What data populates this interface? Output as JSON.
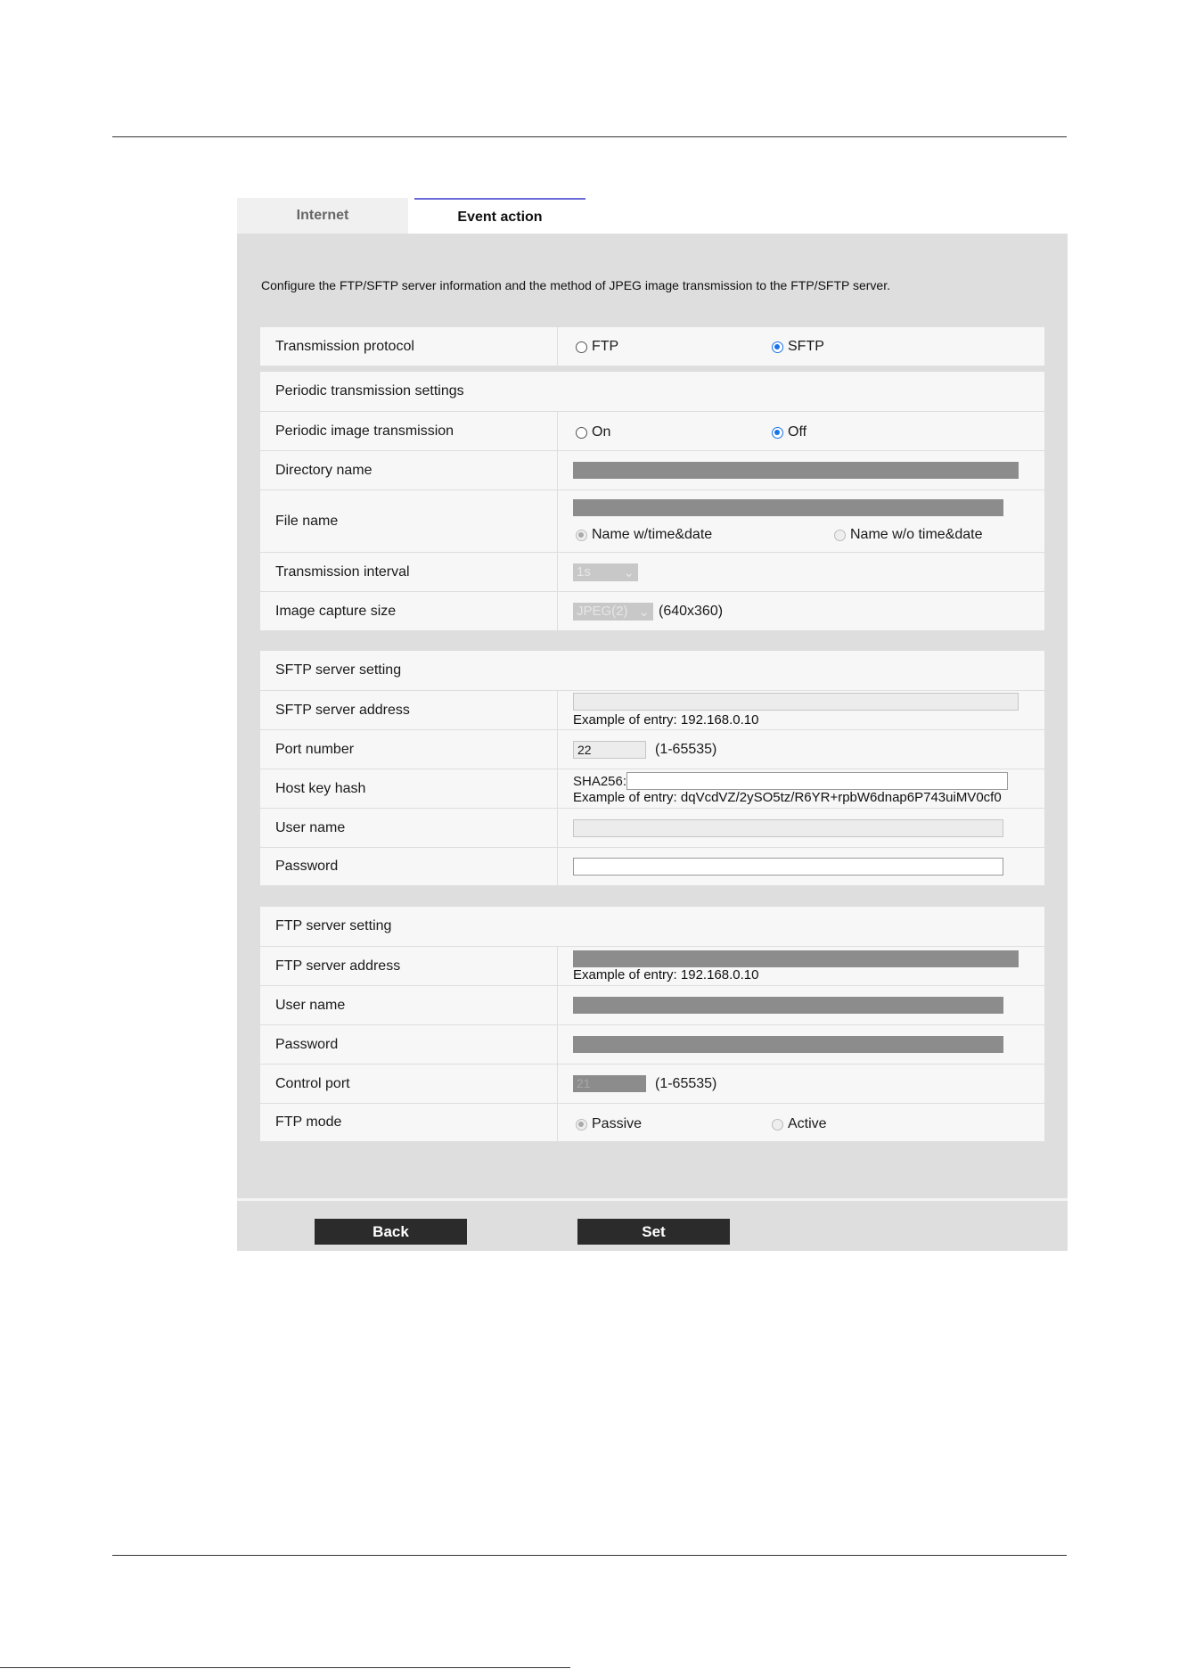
{
  "tabs": [
    {
      "label": "Internet"
    },
    {
      "label": "Event action"
    }
  ],
  "intro": "Configure the FTP/SFTP server information and the method of JPEG image transmission to the FTP/SFTP server.",
  "protocol": {
    "label": "Transmission protocol",
    "opt1": "FTP",
    "opt2": "SFTP",
    "selected": "SFTP"
  },
  "periodic": {
    "header": "Periodic transmission settings",
    "image_tx_label": "Periodic image transmission",
    "on": "On",
    "off": "Off",
    "selected": "Off",
    "dir_label": "Directory name",
    "file_label": "File name",
    "name_with": "Name w/time&date",
    "name_without": "Name w/o time&date",
    "interval_label": "Transmission interval",
    "interval_value": "1s",
    "capture_label": "Image capture size",
    "capture_value": "JPEG(2)",
    "capture_res": "(640x360)"
  },
  "sftp": {
    "header": "SFTP server setting",
    "address_label": "SFTP server address",
    "address_hint": "Example of entry: 192.168.0.10",
    "port_label": "Port number",
    "port_value": "22",
    "port_range": "(1-65535)",
    "hash_label": "Host key hash",
    "hash_prefix": "SHA256:",
    "hash_hint": "Example of entry: dqVcdVZ/2ySO5tz/R6YR+rpbW6dnap6P743uiMV0cf0",
    "user_label": "User name",
    "password_label": "Password"
  },
  "ftp": {
    "header": "FTP server setting",
    "address_label": "FTP server address",
    "address_hint": "Example of entry: 192.168.0.10",
    "user_label": "User name",
    "password_label": "Password",
    "control_label": "Control port",
    "control_value": "21",
    "control_range": "(1-65535)",
    "mode_label": "FTP mode",
    "passive": "Passive",
    "active": "Active",
    "selected": "Passive"
  },
  "buttons": {
    "back": "Back",
    "set": "Set"
  }
}
